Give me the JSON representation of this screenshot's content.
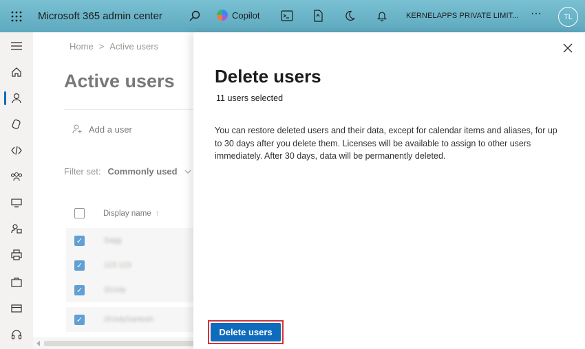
{
  "topbar": {
    "app_title": "Microsoft 365 admin center",
    "copilot_label": "Copilot",
    "org_name": "KERNELAPPS PRIVATE LIMIT...",
    "more_label": "···",
    "avatar_initials": "TL",
    "bg_color": "#6fb8cc"
  },
  "rail": {
    "icons": [
      "menu-icon",
      "home-icon",
      "user-icon",
      "devices-icon",
      "code-icon",
      "groups-icon",
      "printer-icon",
      "user-lock-icon",
      "print-icon",
      "briefcase-icon",
      "billing-icon",
      "headset-icon"
    ],
    "active": "user-icon"
  },
  "page": {
    "breadcrumb": {
      "home": "Home",
      "separator": ">",
      "current": "Active users"
    },
    "title": "Active users",
    "add_user_label": "Add a user",
    "filter_label": "Filter set:",
    "filter_value": "Commonly used",
    "column_display_name": "Display name",
    "sort_arrow": "↑",
    "rows": [
      {
        "name": "Sagg",
        "checked": true
      },
      {
        "name": "123 123",
        "checked": true
      },
      {
        "name": "20July",
        "checked": true
      },
      {
        "name": "20JulySantosh",
        "checked": true
      }
    ]
  },
  "panel": {
    "title": "Delete users",
    "selected_text": "11 users selected",
    "description": "You can restore deleted users and their data, except for calendar items and aliases, for up to 30 days after you delete them. Licenses will be available to assign to other users immediately. After 30 days, data will be permanently deleted.",
    "delete_button_label": "Delete users",
    "accent_color": "#0f6cbd",
    "highlight_color": "#d13438"
  }
}
